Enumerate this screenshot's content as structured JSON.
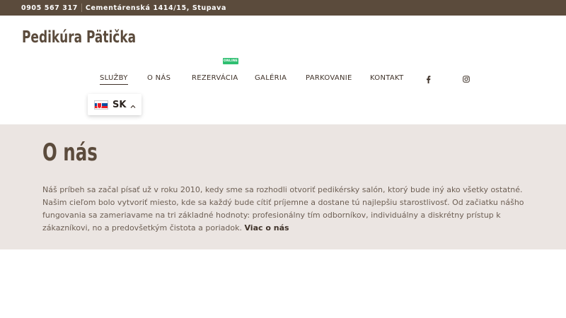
{
  "topbar": {
    "phone": "0905 567 317",
    "address": "Cementárenská 1414/15, Stupava"
  },
  "logo": "Pedikúra Pätička",
  "nav": {
    "items": [
      {
        "label": "SLUŽBY"
      },
      {
        "label": "O NÁS"
      },
      {
        "label": "REZERVÁCIA"
      },
      {
        "label": "GALÉRIA"
      },
      {
        "label": "PARKOVANIE"
      },
      {
        "label": "KONTAKT"
      }
    ],
    "badge": "ONLINE",
    "icons": [
      "facebook-icon",
      "instagram-icon"
    ]
  },
  "language": {
    "code": "SK",
    "flag": "slovak-flag-icon"
  },
  "about": {
    "title": "O nás",
    "text": "Náš príbeh sa začal písať už v roku 2010, kedy sme sa rozhodli otvoriť pedikérsky salón, ktorý bude iný ako všetky ostatné. Našim cieľom bolo vytvoriť miesto, kde sa každý bude cítiť príjemne a dostane tú najlepšiu starostlivosť. Od začiatku nášho fungovania sa zameriavame na tri základné hodnoty: profesionálny tím odborníkov, individuálny a diskrétny prístup k zákazníkovi, no a predovšetkým čistota a poriadok.",
    "link": "Viac o nás"
  },
  "colors": {
    "brand_brown": "#5b4b3c",
    "section_bg": "#ebe5e2",
    "badge_green": "#2fbf71"
  }
}
